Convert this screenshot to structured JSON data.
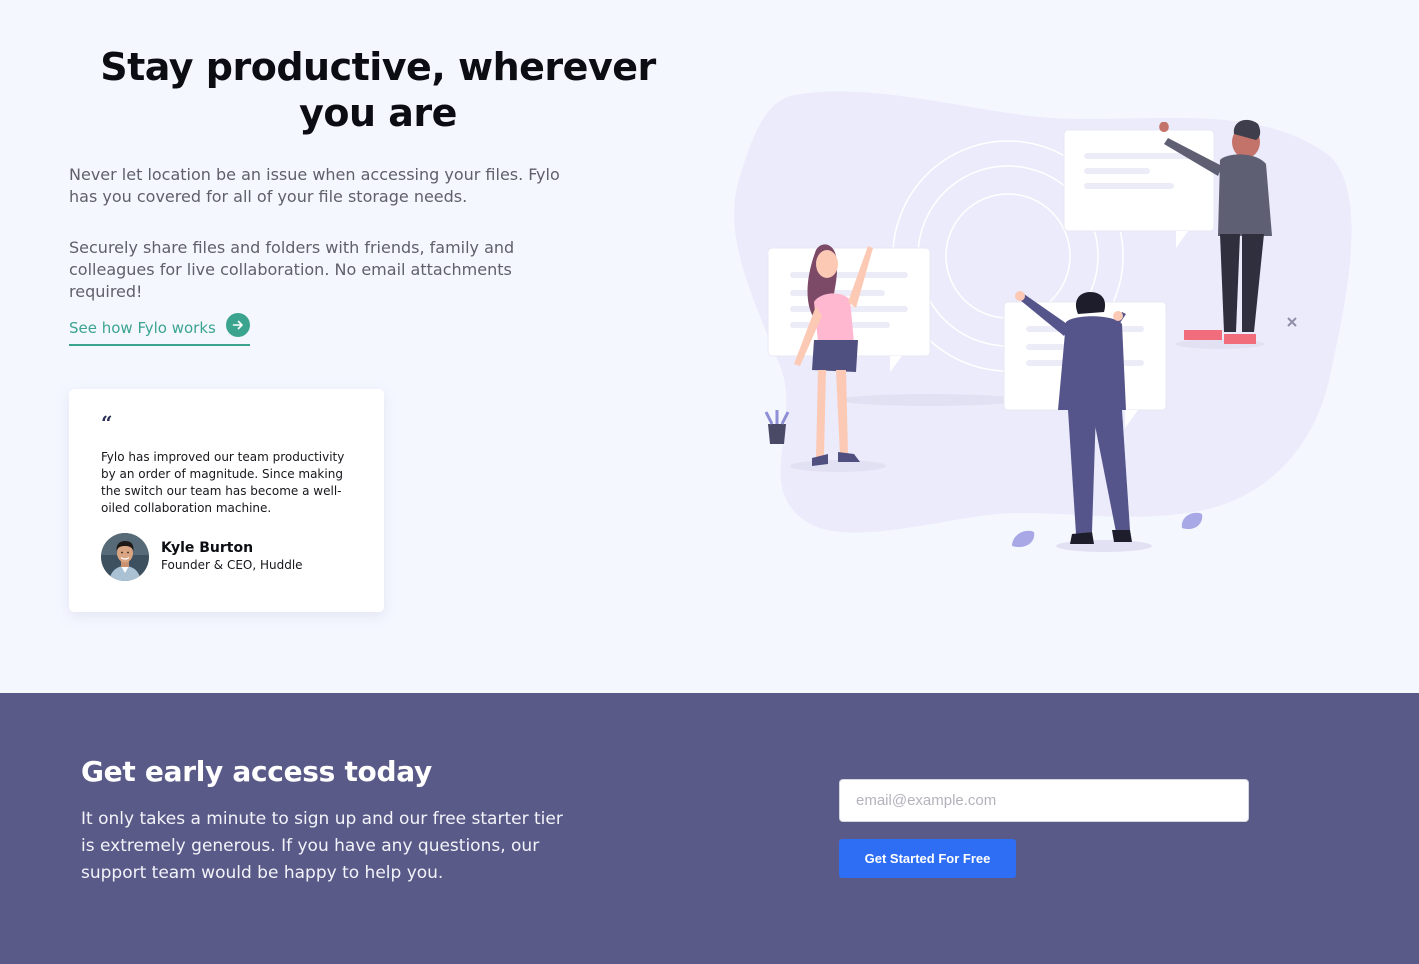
{
  "productive": {
    "headline": "Stay productive, wherever you are",
    "paragraph_1": "Never let location be an issue when accessing your files. Fylo has you covered for all of your file storage needs.",
    "paragraph_2": "Securely share files and folders with friends, family and colleagues for live collaboration. No email attachments required!",
    "link": {
      "label": "See how Fylo works",
      "icon": "arrow-right-icon"
    },
    "illustration": "stay-productive-illustration"
  },
  "testimonial": {
    "quote_icon": "quote-icon",
    "quote": "Fylo has improved our team productivity by an order of magnitude. Since making the switch our team has become a well-oiled collaboration machine.",
    "name": "Kyle Burton",
    "role": "Founder & CEO, Huddle",
    "avatar": "avatar"
  },
  "early_access": {
    "title": "Get early access today",
    "text": "It only takes a minute to sign up and our free starter tier is extremely generous. If you have any questions, our support team would be happy to help you.",
    "email_placeholder": "email@example.com",
    "email_value": "",
    "button_label": "Get Started For Free"
  },
  "colors": {
    "page_background": "#f5f7ff",
    "accent_teal": "#3ba48f",
    "cta_section_background": "#5a5a89",
    "cta_button": "#2e6ef5",
    "heading_text": "#0c0d13"
  }
}
